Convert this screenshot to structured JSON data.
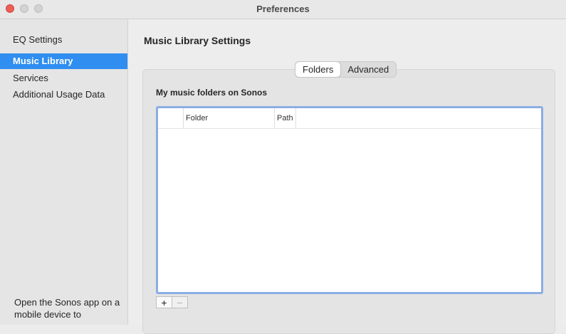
{
  "window": {
    "title": "Preferences"
  },
  "sidebar": {
    "items": [
      {
        "label": "EQ Settings"
      },
      {
        "label": "Music Library"
      },
      {
        "label": "Services"
      },
      {
        "label": "Additional Usage Data"
      }
    ],
    "selected": "Music Library",
    "footer": "Open the Sonos app on a mobile device to"
  },
  "main": {
    "title": "Music Library Settings",
    "tabs": [
      {
        "label": "Folders"
      },
      {
        "label": "Advanced"
      }
    ],
    "active_tab": "Folders",
    "section_label": "My music folders on Sonos",
    "table": {
      "columns": [
        "",
        "Folder",
        "Path"
      ],
      "rows": []
    },
    "buttons": {
      "add": "+",
      "remove": "−"
    }
  }
}
